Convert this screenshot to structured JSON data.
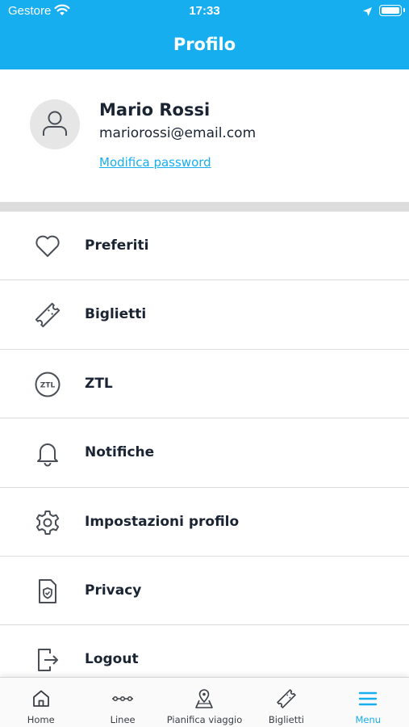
{
  "status_bar": {
    "carrier": "Gestore",
    "time": "17:33"
  },
  "header": {
    "title": "Profilo"
  },
  "profile": {
    "name": "Mario Rossi",
    "email": "mariorossi@email.com",
    "change_password_label": "Modifica password"
  },
  "menu": {
    "items": [
      {
        "label": "Preferiti",
        "icon": "heart-icon"
      },
      {
        "label": "Biglietti",
        "icon": "ticket-icon"
      },
      {
        "label": "ZTL",
        "icon": "ztl-icon",
        "icon_text": "ZTL"
      },
      {
        "label": "Notifiche",
        "icon": "bell-icon"
      },
      {
        "label": "Impostazioni profilo",
        "icon": "gear-icon"
      },
      {
        "label": "Privacy",
        "icon": "privacy-shield-icon"
      },
      {
        "label": "Logout",
        "icon": "logout-icon"
      }
    ]
  },
  "tabbar": {
    "tabs": [
      {
        "label": "Home",
        "icon": "home-icon"
      },
      {
        "label": "Linee",
        "icon": "lines-icon"
      },
      {
        "label": "Pianifica viaggio",
        "icon": "map-pin-icon"
      },
      {
        "label": "Biglietti",
        "icon": "ticket-icon"
      },
      {
        "label": "Menu",
        "icon": "menu-icon"
      }
    ],
    "active": "Menu"
  },
  "colors": {
    "accent": "#17aef0",
    "text": "#1a2433",
    "separator": "#dddddd"
  }
}
